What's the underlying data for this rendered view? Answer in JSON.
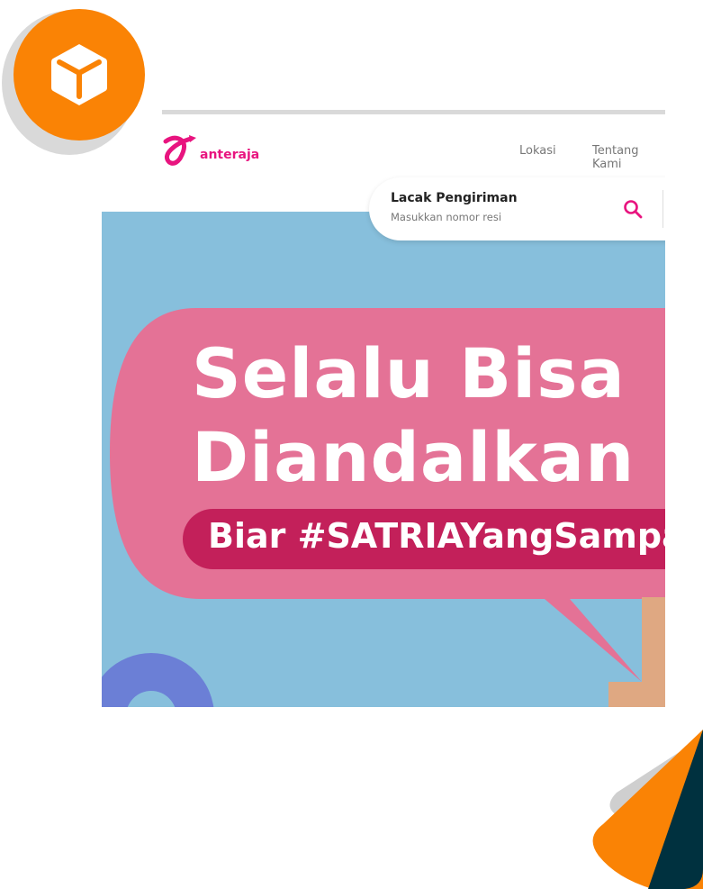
{
  "header": {
    "logo_text": "anteraja",
    "nav": [
      "Lokasi",
      "Tentang Kami"
    ]
  },
  "search": {
    "title": "Lacak Pengiriman",
    "placeholder": "Masukkan nomor resi",
    "icon": "search-icon"
  },
  "hero": {
    "line1": "Selalu Bisa",
    "line2": "Diandalkan",
    "tagline": "Biar #SATRIAYangSampai"
  },
  "colors": {
    "orange": "#fa8305",
    "brand_pink": "#e8147f",
    "bubble_pink": "#e47296",
    "tagline_bg": "#c3205a",
    "hero_bg": "#87bfdc",
    "dark_teal": "#00313f"
  }
}
